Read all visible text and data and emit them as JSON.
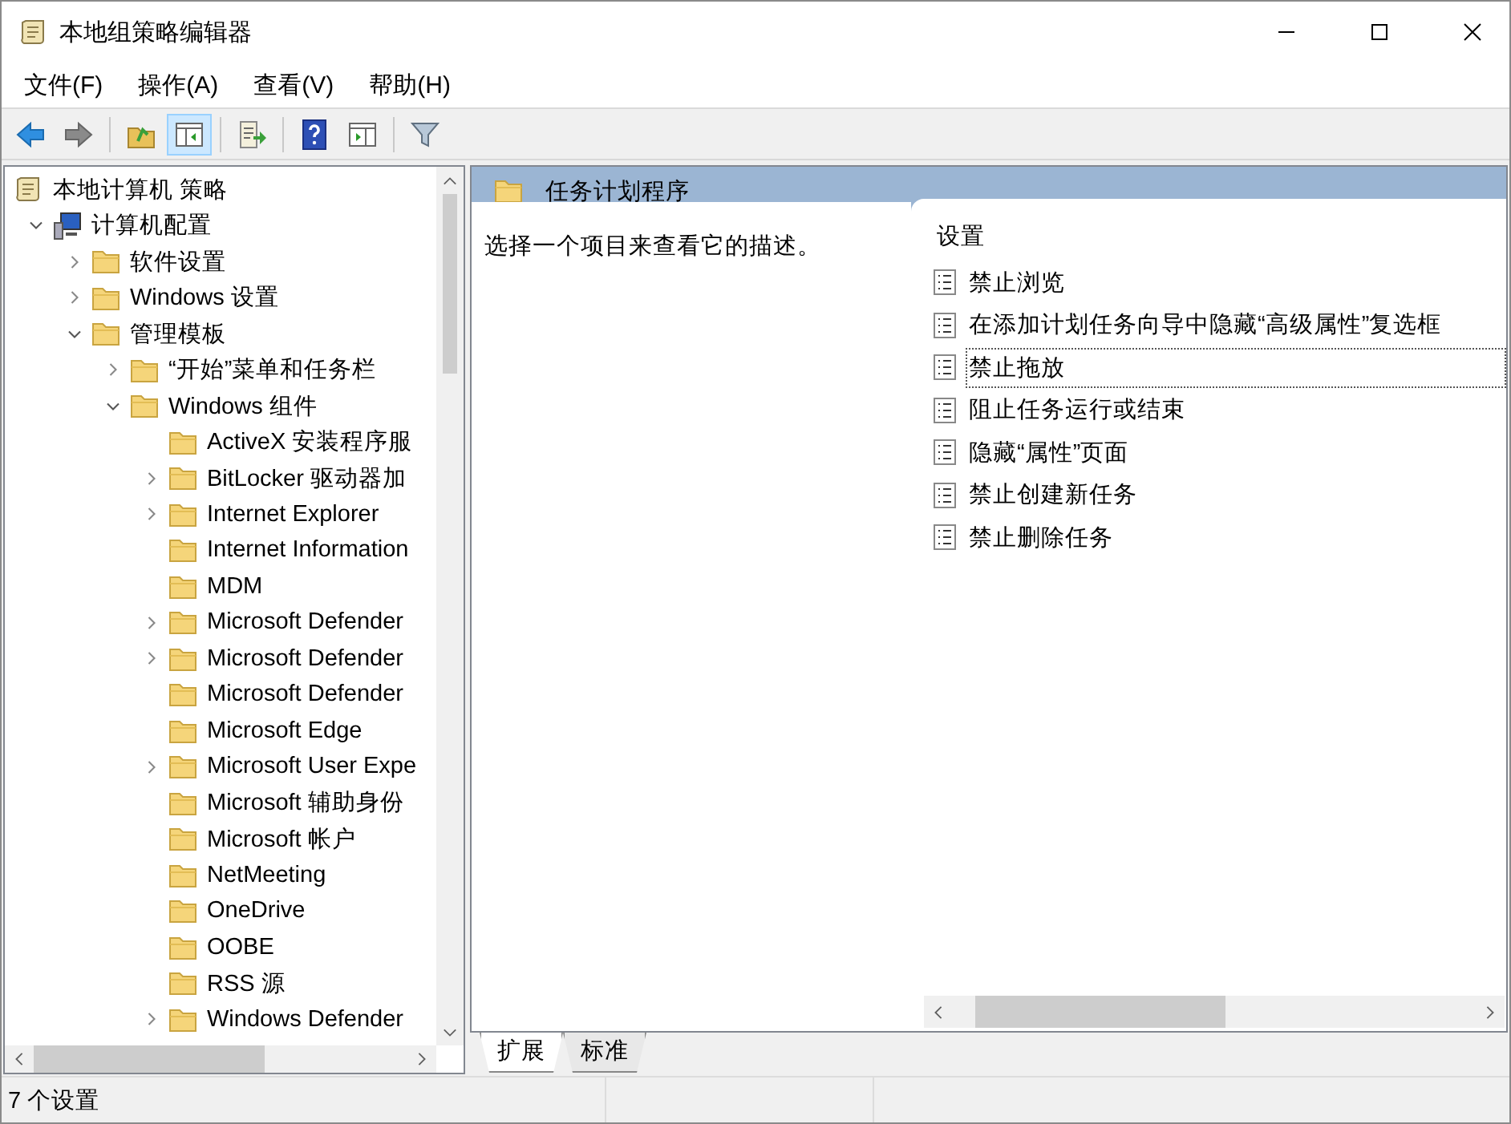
{
  "window": {
    "title": "本地组策略编辑器"
  },
  "menu": [
    "文件(F)",
    "操作(A)",
    "查看(V)",
    "帮助(H)"
  ],
  "toolbar": [
    [
      {
        "kind": "back",
        "selected": false
      },
      {
        "kind": "forward",
        "selected": false
      }
    ],
    [
      {
        "kind": "up",
        "selected": false
      },
      {
        "kind": "tree",
        "selected": true
      }
    ],
    [
      {
        "kind": "export",
        "selected": false
      }
    ],
    [
      {
        "kind": "help",
        "selected": false
      },
      {
        "kind": "actions",
        "selected": false
      }
    ],
    [
      {
        "kind": "filter",
        "selected": false
      }
    ]
  ],
  "tree": [
    {
      "label": "本地计算机 策略",
      "kind": "root",
      "children": [
        {
          "label": "计算机配置",
          "kind": "branch",
          "expanded": true,
          "children": [
            {
              "label": "软件设置",
              "kind": "branch",
              "expanded": false
            },
            {
              "label": "Windows 设置",
              "kind": "branch",
              "expanded": false
            },
            {
              "label": "管理模板",
              "kind": "branch",
              "expanded": true,
              "children": [
                {
                  "label": "“开始”菜单和任务栏",
                  "kind": "branch",
                  "expanded": false
                },
                {
                  "label": "Windows 组件",
                  "kind": "branch",
                  "expanded": true,
                  "children": [
                    {
                      "label": "ActiveX 安装程序服",
                      "kind": "leaf"
                    },
                    {
                      "label": "BitLocker 驱动器加",
                      "kind": "branch",
                      "expanded": false
                    },
                    {
                      "label": "Internet Explorer",
                      "kind": "branch",
                      "expanded": false
                    },
                    {
                      "label": "Internet Information",
                      "kind": "leaf"
                    },
                    {
                      "label": "MDM",
                      "kind": "leaf"
                    },
                    {
                      "label": "Microsoft Defender",
                      "kind": "branch",
                      "expanded": false
                    },
                    {
                      "label": "Microsoft Defender",
                      "kind": "branch",
                      "expanded": false
                    },
                    {
                      "label": "Microsoft Defender",
                      "kind": "leaf"
                    },
                    {
                      "label": "Microsoft Edge",
                      "kind": "leaf"
                    },
                    {
                      "label": "Microsoft User Expe",
                      "kind": "branch",
                      "expanded": false
                    },
                    {
                      "label": "Microsoft 辅助身份",
                      "kind": "leaf"
                    },
                    {
                      "label": "Microsoft 帐户",
                      "kind": "leaf"
                    },
                    {
                      "label": "NetMeeting",
                      "kind": "leaf"
                    },
                    {
                      "label": "OneDrive",
                      "kind": "leaf"
                    },
                    {
                      "label": "OOBE",
                      "kind": "leaf"
                    },
                    {
                      "label": "RSS 源",
                      "kind": "leaf"
                    },
                    {
                      "label": "Windows Defender",
                      "kind": "branch",
                      "expanded": false
                    }
                  ]
                }
              ]
            }
          ]
        }
      ]
    }
  ],
  "details": {
    "title": "任务计划程序",
    "description": "选择一个项目来查看它的描述。",
    "column": "设置",
    "settings": [
      {
        "label": "禁止浏览",
        "focused": false
      },
      {
        "label": "在添加计划任务向导中隐藏“高级属性”复选框",
        "focused": false
      },
      {
        "label": "禁止拖放",
        "focused": true
      },
      {
        "label": "阻止任务运行或结束",
        "focused": false
      },
      {
        "label": "隐藏“属性”页面",
        "focused": false
      },
      {
        "label": "禁止创建新任务",
        "focused": false
      },
      {
        "label": "禁止删除任务",
        "focused": false
      }
    ]
  },
  "tabs": [
    {
      "label": "扩展",
      "selected": true
    },
    {
      "label": "标准",
      "selected": false
    }
  ],
  "status_bar": [
    "7 个设置"
  ]
}
